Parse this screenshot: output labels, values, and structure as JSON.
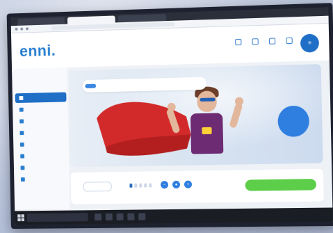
{
  "site": {
    "logo": "enni.",
    "nav": [
      "",
      "",
      ""
    ],
    "header_icons": [
      {
        "icon": "search-icon",
        "label": ""
      },
      {
        "icon": "heart-icon",
        "label": ""
      },
      {
        "icon": "cart-icon",
        "label": ""
      },
      {
        "icon": "user-icon",
        "label": ""
      }
    ],
    "menu_icon": "menu-icon"
  },
  "sidebar": {
    "greeting": "",
    "items": [
      {
        "label": "",
        "active": true
      },
      {
        "label": "",
        "active": false
      },
      {
        "label": "",
        "active": false
      },
      {
        "label": "",
        "active": false
      },
      {
        "label": "",
        "active": false
      },
      {
        "label": "",
        "active": false
      },
      {
        "label": "",
        "active": false
      },
      {
        "label": "",
        "active": false
      }
    ]
  },
  "hero": {
    "tabs": [
      "",
      "",
      "",
      ""
    ],
    "badge": ""
  },
  "panel": {
    "col1_label": "",
    "col1_value": "",
    "col2_label": "",
    "col2_value": "",
    "cta": ""
  },
  "taskbar": {
    "tray": ""
  },
  "colors": {
    "brand_blue": "#1f6fc6",
    "cta_green": "#5dce4a",
    "hero_badge": "#2f7fe0"
  }
}
